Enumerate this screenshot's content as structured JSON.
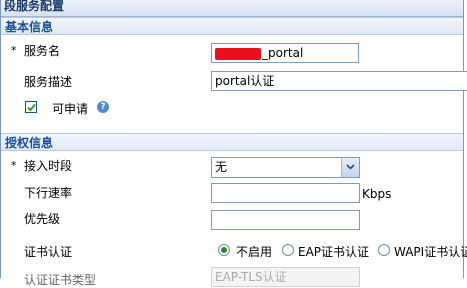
{
  "window": {
    "title": "段服务配置"
  },
  "basic_section": {
    "title": "基本信息"
  },
  "service_name": {
    "required_mark": "*",
    "label": "服务名",
    "value": "_portal"
  },
  "service_desc": {
    "label": "服务描述",
    "value": "portal认证"
  },
  "applicable": {
    "label": "可申请",
    "checked": true,
    "help_icon": "question-circle-icon"
  },
  "auth_section": {
    "title": "授权信息"
  },
  "access_period": {
    "required_mark": "*",
    "label": "接入时段",
    "selected": "无"
  },
  "downlink_rate": {
    "label": "下行速率",
    "value": "",
    "unit": "Kbps"
  },
  "priority": {
    "label": "优先级",
    "value": ""
  },
  "cert_auth": {
    "label": "证书认证",
    "options": [
      "不启用",
      "EAP证书认证",
      "WAPI证书认证"
    ],
    "selected": "不启用"
  },
  "cert_type": {
    "label": "认证证书类型",
    "value": "EAP-TLS认证"
  },
  "colors": {
    "section_title": "#1a4e96",
    "required_field_marker": "#e8101a",
    "radio_selected": "#2a8a2a"
  }
}
